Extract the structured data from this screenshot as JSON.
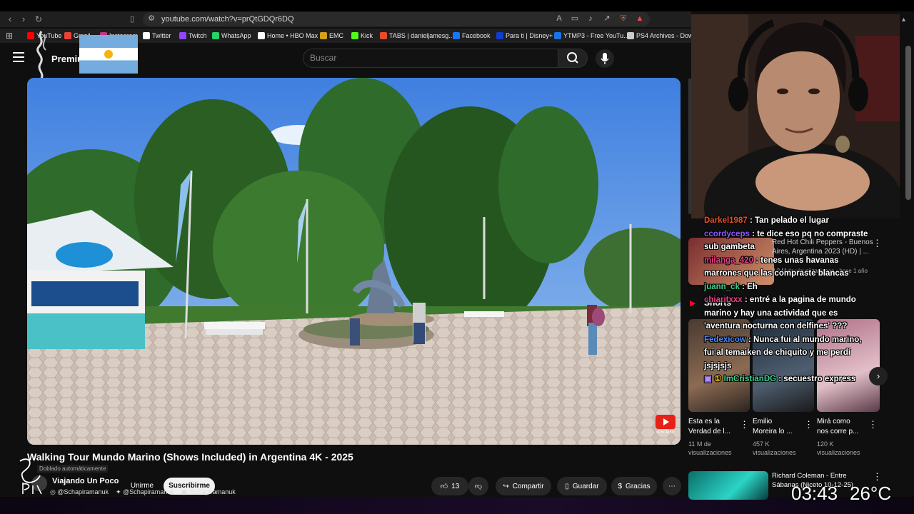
{
  "browser": {
    "url": "youtube.com/watch?v=prQtGDQr6DQ",
    "bookmarks": [
      {
        "label": "YouTube",
        "icon": "youtube-icon",
        "color": "#ff0000"
      },
      {
        "label": "Gmail",
        "icon": "gmail-icon",
        "color": "#ea4335"
      },
      {
        "label": "Instagram",
        "icon": "instagram-icon",
        "color": "#c13584"
      },
      {
        "label": "Twitter",
        "icon": "x-icon",
        "color": "#ffffff"
      },
      {
        "label": "Twitch",
        "icon": "twitch-icon",
        "color": "#9146ff"
      },
      {
        "label": "WhatsApp",
        "icon": "whatsapp-icon",
        "color": "#25d366"
      },
      {
        "label": "Home • HBO Max",
        "icon": "hbo-icon",
        "color": "#ffffff"
      },
      {
        "label": "EMC",
        "icon": "emc-icon",
        "color": "#d4a017"
      },
      {
        "label": "Kick",
        "icon": "kick-icon",
        "color": "#53fc18"
      },
      {
        "label": "TABS | danieljamesg...",
        "icon": "tabs-icon",
        "color": "#e84a2a"
      },
      {
        "label": "Facebook",
        "icon": "facebook-icon",
        "color": "#1877f2"
      },
      {
        "label": "Para ti | Disney+",
        "icon": "disney-icon",
        "color": "#113ccf"
      },
      {
        "label": "YTMP3 - Free YouTu...",
        "icon": "ytmp3-icon",
        "color": "#1a73e8"
      },
      {
        "label": "PS4 Archives - Dow...",
        "icon": "globe-icon",
        "color": "#cccccc"
      }
    ]
  },
  "youtube": {
    "logo_suffix": "Premium",
    "search_placeholder": "Buscar",
    "video_title": "Walking Tour Mundo Marino (Shows Included) in Argentina 4K - 2025",
    "dubbed_label": "Doblado automáticamente",
    "channel_name": "Viajando Un Poco",
    "join_label": "Unirme",
    "subscribe_label": "Suscribirme",
    "like_count": "13",
    "share_label": "Compartir",
    "save_label": "Guardar",
    "thanks_label": "Gracias"
  },
  "sidebar": {
    "song": {
      "title_line1": "Red Hot Chili Peppers - Buenos",
      "title_line2": "Aires, Argentina 2023 (HD) | ...",
      "meta": "3,2 M de visualizaciones • hace 1 año"
    },
    "shorts_label": "Shorts",
    "shorts": [
      {
        "title_line1": "Esta es la",
        "title_line2": "Verdad de l...",
        "views_line1": "11 M de",
        "views_line2": "visualizaciones"
      },
      {
        "title_line1": "Emilio",
        "title_line2": "Moreira lo ...",
        "views_line1": "457 K",
        "views_line2": "visualizaciones"
      },
      {
        "title_line1": "Mirá como",
        "title_line2": "nos corre p...",
        "views_line1": "120 K",
        "views_line2": "visualizaciones"
      }
    ],
    "next_video": {
      "title_line1": "Richard Coleman - Entre",
      "title_line2": "Sábanas (Niceto 10-12-25)"
    }
  },
  "overlay": {
    "socials": [
      "@Schapiramanuk",
      "@Schapiramanuk",
      "/Schapiramanuk"
    ],
    "chat": [
      {
        "user": "Darkel1987",
        "color": "#e0522a",
        "message": " : Tan pelado el lugar"
      },
      {
        "user": "ccordyceps",
        "color": "#8a5cff",
        "message": " : te dice eso pq no compraste sub gambeta"
      },
      {
        "user": "milanga_420",
        "color": "#ee3f86",
        "message": " : tenes unas havanas marrones que las compraste blancas"
      },
      {
        "user": "juann_ck",
        "color": "#3fd38e",
        "message": " : Eh"
      },
      {
        "user": "chiaritxxx",
        "color": "#ee3f86",
        "message": " : entré a la pagina de mundo marino y hay una actividad que es 'aventura nocturna con delfines' ???"
      },
      {
        "user": "Fedexicow",
        "color": "#4a8cff",
        "message": " : Nunca fui al mundo marino, fui al temaiken de chiquito y me perdí jsjsjsjs"
      },
      {
        "user": "ImCristianDG",
        "color": "#3fd38e",
        "message": " : secuestro express",
        "badges": true
      }
    ],
    "clock": "03:43",
    "temperature": "26°C"
  }
}
